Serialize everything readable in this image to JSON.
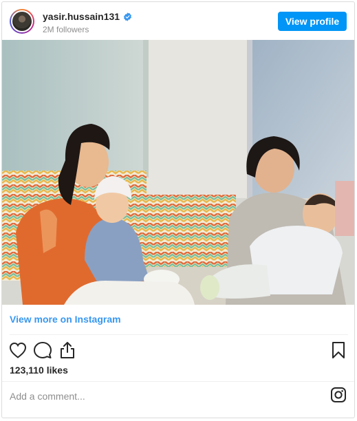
{
  "header": {
    "username": "yasir.hussain131",
    "followers": "2M followers",
    "view_profile_label": "View profile",
    "verified_color": "#3897f0"
  },
  "photo": {
    "subject": "post-photo"
  },
  "view_more_label": "View more on Instagram",
  "actions": {
    "like_icon": "heart-icon",
    "comment_icon": "comment-icon",
    "share_icon": "share-icon",
    "save_icon": "bookmark-icon"
  },
  "likes": "123,110 likes",
  "comment": {
    "placeholder": "Add a comment..."
  },
  "colors": {
    "primary_button": "#0095f6",
    "link": "#3897f0",
    "text": "#262626",
    "secondary_text": "#8e8e8e"
  }
}
